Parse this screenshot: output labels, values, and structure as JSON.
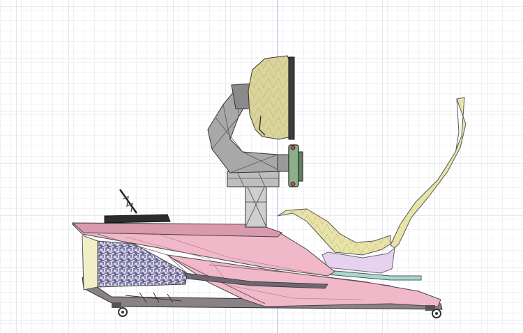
{
  "viewport": {
    "background": "#ffffff",
    "grid_minor_color": "#e6e6ee",
    "grid_major_color": "#c9c9d6",
    "axis_color": "#9a9ae0",
    "grid_visible": true
  },
  "model": {
    "parts": [
      "base-frame",
      "seat",
      "wheel-mast",
      "monitor",
      "steering-wheel",
      "pedal-unit",
      "front-panel",
      "castor-wheels"
    ],
    "colors": {
      "frame_pink": "#f0b8c8",
      "frame_dark": "#7a7078",
      "seat_yellow": "#e8e4a8",
      "monitor_khaki": "#d8d49a",
      "wheel_green": "#8ab08a",
      "cushion_lilac": "#e6d2ee",
      "rail_teal": "#a8d8d0",
      "panel_cream": "#f2eec8",
      "mesh_purple": "#6a6a98",
      "mast_grey": "#cfcfcf",
      "line_dark": "#333333"
    }
  }
}
